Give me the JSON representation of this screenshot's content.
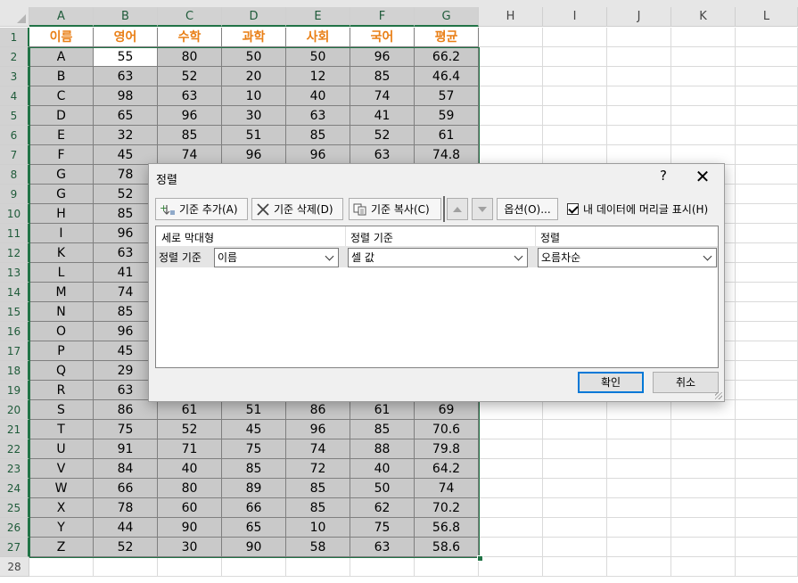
{
  "spreadsheet": {
    "columns": [
      "A",
      "B",
      "C",
      "D",
      "E",
      "F",
      "G",
      "H",
      "I",
      "J",
      "K",
      "L"
    ],
    "header_row": [
      "이름",
      "영어",
      "수학",
      "과학",
      "사회",
      "국어",
      "평균"
    ],
    "rows": [
      [
        "A",
        "55",
        "80",
        "50",
        "50",
        "96",
        "66.2"
      ],
      [
        "B",
        "63",
        "52",
        "20",
        "12",
        "85",
        "46.4"
      ],
      [
        "C",
        "98",
        "63",
        "10",
        "40",
        "74",
        "57"
      ],
      [
        "D",
        "65",
        "96",
        "30",
        "63",
        "41",
        "59"
      ],
      [
        "E",
        "32",
        "85",
        "51",
        "85",
        "52",
        "61"
      ],
      [
        "F",
        "45",
        "74",
        "96",
        "96",
        "63",
        "74.8"
      ],
      [
        "G",
        "78",
        "",
        "",
        "",
        "",
        ""
      ],
      [
        "G",
        "52",
        "",
        "",
        "",
        "",
        ""
      ],
      [
        "H",
        "85",
        "",
        "",
        "",
        "",
        ""
      ],
      [
        "I",
        "96",
        "",
        "",
        "",
        "",
        ""
      ],
      [
        "K",
        "63",
        "",
        "",
        "",
        "",
        ""
      ],
      [
        "L",
        "41",
        "",
        "",
        "",
        "",
        ""
      ],
      [
        "M",
        "74",
        "",
        "",
        "",
        "",
        ""
      ],
      [
        "N",
        "85",
        "",
        "",
        "",
        "",
        ""
      ],
      [
        "O",
        "96",
        "",
        "",
        "",
        "",
        ""
      ],
      [
        "P",
        "45",
        "",
        "",
        "",
        "",
        ""
      ],
      [
        "Q",
        "29",
        "",
        "",
        "",
        "",
        ""
      ],
      [
        "R",
        "63",
        "",
        "",
        "",
        "",
        ""
      ],
      [
        "S",
        "86",
        "61",
        "51",
        "86",
        "61",
        "69"
      ],
      [
        "T",
        "75",
        "52",
        "45",
        "96",
        "85",
        "70.6"
      ],
      [
        "U",
        "91",
        "71",
        "75",
        "74",
        "88",
        "79.8"
      ],
      [
        "V",
        "84",
        "40",
        "85",
        "72",
        "40",
        "64.2"
      ],
      [
        "W",
        "66",
        "80",
        "89",
        "85",
        "50",
        "74"
      ],
      [
        "X",
        "78",
        "60",
        "66",
        "85",
        "62",
        "70.2"
      ],
      [
        "Y",
        "44",
        "90",
        "65",
        "10",
        "75",
        "56.8"
      ],
      [
        "Z",
        "52",
        "30",
        "90",
        "58",
        "63",
        "58.6"
      ]
    ],
    "row_numbers": [
      "1",
      "2",
      "3",
      "4",
      "5",
      "6",
      "7",
      "8",
      "9",
      "10",
      "11",
      "12",
      "13",
      "14",
      "15",
      "16",
      "17",
      "18",
      "19",
      "20",
      "21",
      "22",
      "23",
      "24",
      "25",
      "26",
      "27",
      "28"
    ],
    "header_text_color": "#e97f16",
    "selection_color": "#217346"
  },
  "sort_dialog": {
    "title": "정렬",
    "help_label": "?",
    "close_label": "✕",
    "toolbar": {
      "add_level": "기준 추가(A)",
      "delete_level": "기준 삭제(D)",
      "copy_level": "기준 복사(C)",
      "options": "옵션(O)...",
      "my_data_has_headers": "내 데이터에 머리글 표시(H)",
      "my_data_has_headers_checked": true
    },
    "grid_headers": {
      "column": "세로 막대형",
      "sort_on": "정렬 기준",
      "order": "정렬"
    },
    "level": {
      "row_label": "정렬 기준",
      "column_value": "이름",
      "sort_on_value": "셀 값",
      "order_value": "오름차순"
    },
    "ok_label": "확인",
    "cancel_label": "취소"
  }
}
